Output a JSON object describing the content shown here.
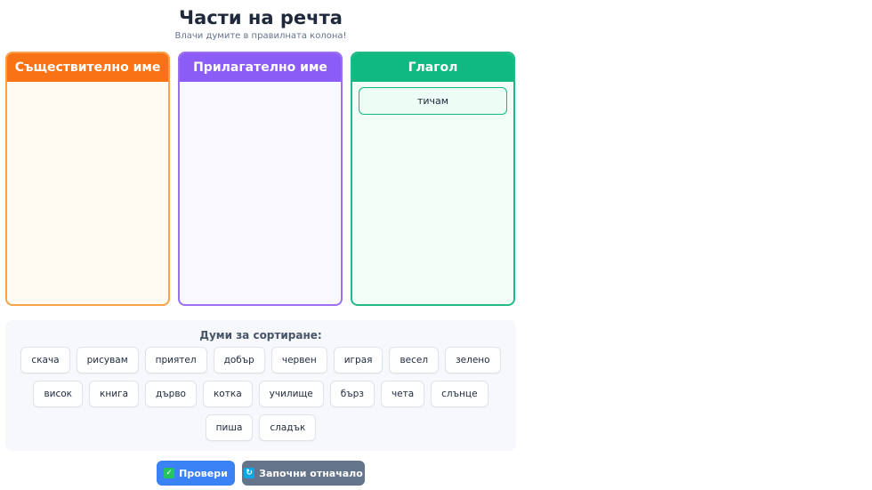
{
  "header": {
    "title": "Части на речта",
    "subtitle": "Влачи думите в правилната колона!"
  },
  "columns": [
    {
      "label": "Съществително име",
      "color": "#f97316",
      "words": []
    },
    {
      "label": "Прилагателно име",
      "color": "#8b5cf6",
      "words": []
    },
    {
      "label": "Глагол",
      "color": "#10b981",
      "words": [
        "тичам"
      ]
    }
  ],
  "bank": {
    "title": "Думи за сортиране:",
    "rows": [
      [
        "скача",
        "рисувам",
        "приятел",
        "добър",
        "червен",
        "играя",
        "весел",
        "зелено"
      ],
      [
        "висок",
        "книга",
        "дърво",
        "котка",
        "училище",
        "бърз",
        "чета",
        "слънце"
      ],
      [
        "пиша",
        "сладък"
      ]
    ]
  },
  "buttons": {
    "check_icon": "✓",
    "check_label": "Провери",
    "reset_icon": "↻",
    "reset_label": "Започни отначало"
  }
}
